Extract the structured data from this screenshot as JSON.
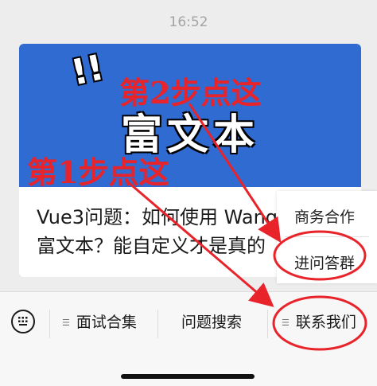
{
  "status_bar": {
    "time": "16:52"
  },
  "article_card": {
    "banner_mark": "!!",
    "banner_title": "富文本",
    "title_line1": "Vue3问题：如何使用 Wang",
    "title_line2": "富文本？能自定义才是真的"
  },
  "annotations": {
    "step2": "第2步点这",
    "step1": "第1步点这"
  },
  "popup_menu": {
    "items": [
      {
        "label": "商务合作"
      },
      {
        "label": "进问答群"
      }
    ]
  },
  "bottom_menu": {
    "items": [
      {
        "label": "面试合集",
        "icon": "list-icon"
      },
      {
        "label": "问题搜索"
      },
      {
        "label": "联系我们",
        "icon": "list-icon"
      }
    ]
  },
  "colors": {
    "annotation_red": "#e8232a",
    "banner_blue": "#2f6bd0"
  }
}
